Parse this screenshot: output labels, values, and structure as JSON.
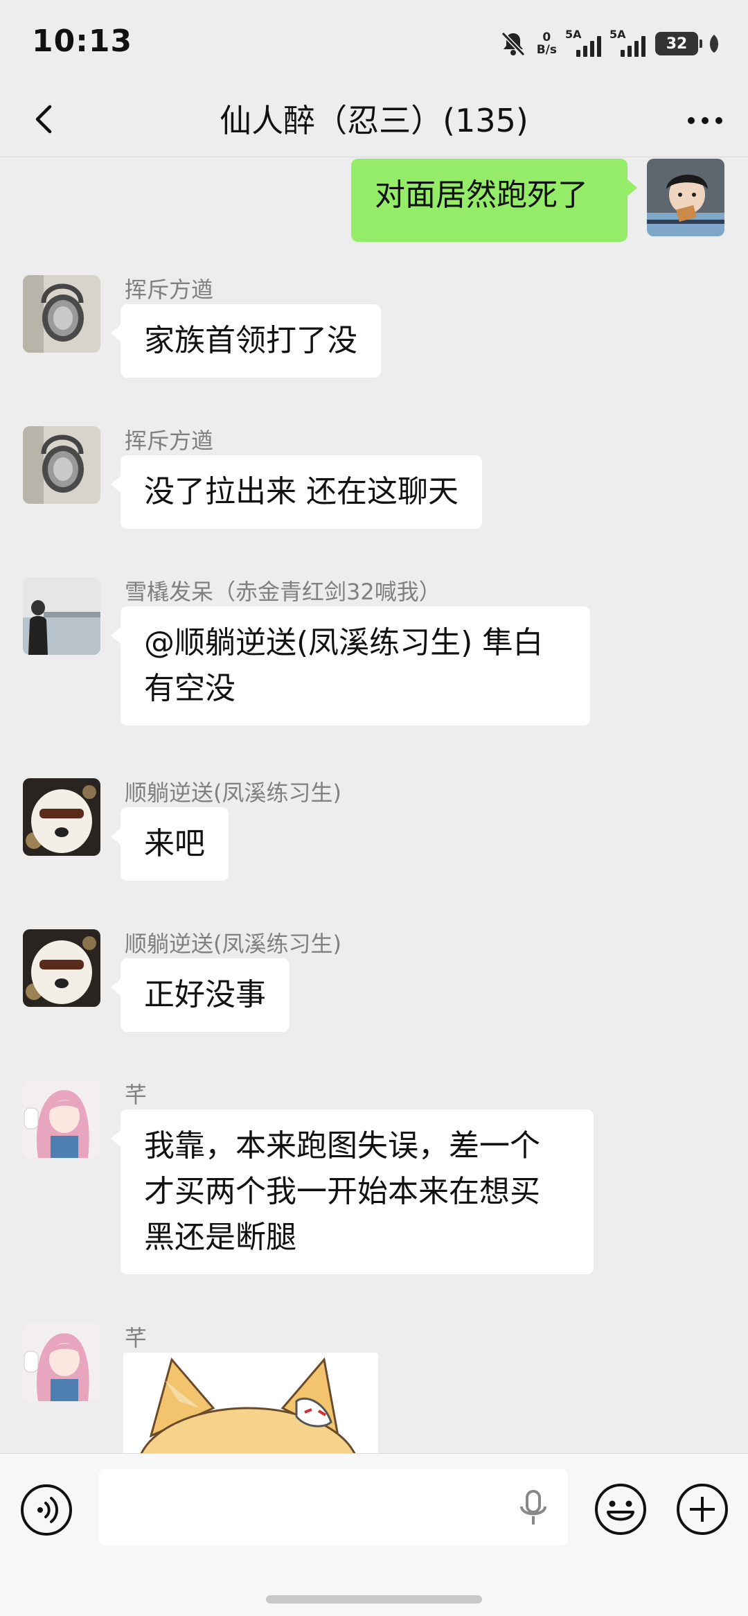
{
  "status_bar": {
    "time": "10:13",
    "net_speed_value": "0",
    "net_speed_unit": "B/s",
    "sim1_label": "5A",
    "sim2_label": "5A",
    "battery": "32"
  },
  "header": {
    "title": "仙人醉（忍三）(135)",
    "back_icon": "chevron-left-icon",
    "more_icon": "ellipsis-icon"
  },
  "messages": [
    {
      "type": "self",
      "text": "对面居然跑死了"
    },
    {
      "type": "other",
      "sender": "挥斥方遒",
      "text": "家族首领打了没"
    },
    {
      "type": "other",
      "sender": "挥斥方遒",
      "text": "没了拉出来 还在这聊天"
    },
    {
      "type": "other",
      "sender": "雪橇发呆（赤金青红剑32喊我）",
      "line1": "@顺躺逆送(凤溪练习生) 隼白",
      "line2": "有空没"
    },
    {
      "type": "other",
      "sender": "顺躺逆送(凤溪练习生)",
      "text": "来吧"
    },
    {
      "type": "other",
      "sender": "顺躺逆送(凤溪练习生)",
      "text": "正好没事"
    },
    {
      "type": "other",
      "sender": "芊",
      "line1": "我靠，本来跑图失误，差一个",
      "line2": "才买两个我一开始本来在想买",
      "line3": "黑还是断腿"
    },
    {
      "type": "other-image",
      "sender": "芊"
    }
  ],
  "input_bar": {
    "placeholder": "",
    "voice_icon": "voice-icon",
    "mic_icon": "microphone-icon",
    "emoji_icon": "emoji-icon",
    "plus_icon": "plus-icon"
  },
  "colors": {
    "background": "#ededed",
    "self_bubble": "#95ec69",
    "other_bubble": "#ffffff",
    "sender_name": "#808080"
  }
}
